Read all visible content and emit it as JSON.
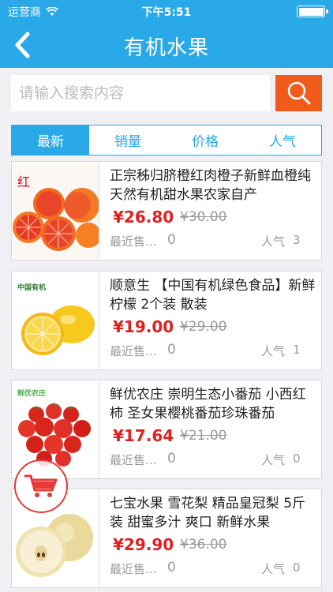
{
  "status": {
    "carrier": "运营商",
    "time": "下午5:51"
  },
  "nav": {
    "title": "有机水果"
  },
  "search": {
    "placeholder": "请输入搜索内容"
  },
  "tabs": [
    {
      "label": "最新"
    },
    {
      "label": "销量"
    },
    {
      "label": "价格"
    },
    {
      "label": "人气"
    }
  ],
  "products": [
    {
      "title": "正宗秭归脐橙红肉橙子新鲜血橙纯天然有机甜水果农家自产",
      "price": "¥26.80",
      "old_price": "¥30.00",
      "sales_label": "最近售…",
      "sales": "0",
      "pop_label": "人气",
      "pop": "3",
      "image_text": "红"
    },
    {
      "title": "顺意生 【中国有机绿色食品】新鲜柠檬 2个装 散装",
      "price": "¥19.00",
      "old_price": "¥29.00",
      "sales_label": "最近售…",
      "sales": "0",
      "pop_label": "人气",
      "pop": "1",
      "image_text": "中国有机"
    },
    {
      "title": "鲜优农庄 崇明生态小番茄 小西红柿 圣女果樱桃番茄珍珠番茄",
      "price": "¥17.64",
      "old_price": "¥21.00",
      "sales_label": "最近售…",
      "sales": "0",
      "pop_label": "人气",
      "pop": "0",
      "image_text": "鲜优农庄"
    },
    {
      "title": "七宝水果 雪花梨 精品皇冠梨 5斤装 甜蜜多汁 爽口 新鲜水果",
      "price": "¥29.90",
      "old_price": "¥36.00",
      "sales_label": "最近售…",
      "sales": "0",
      "pop_label": "人气",
      "pop": "0",
      "image_text": ""
    }
  ]
}
